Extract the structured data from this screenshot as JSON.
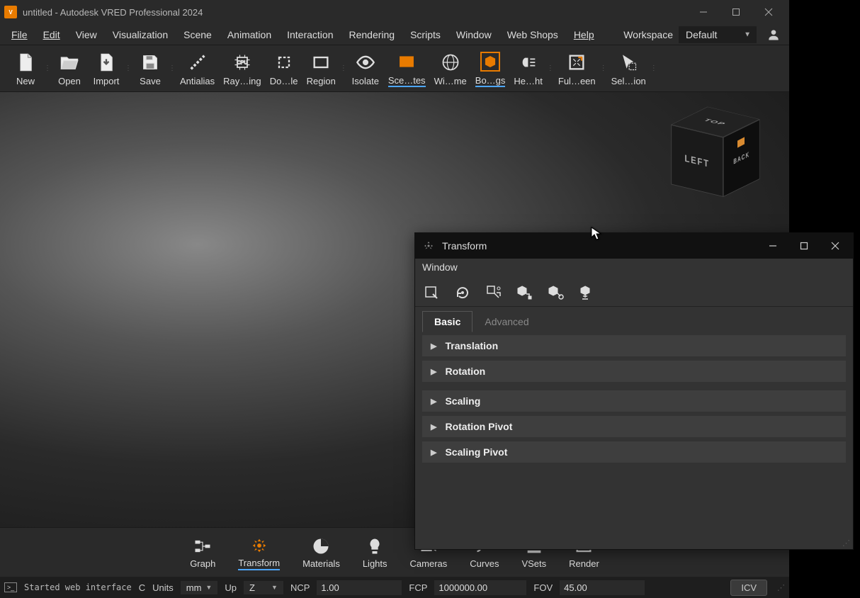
{
  "title": "untitled - Autodesk VRED Professional 2024",
  "app_icon_text": "V",
  "menu": {
    "items": [
      "File",
      "Edit",
      "View",
      "Visualization",
      "Scene",
      "Animation",
      "Interaction",
      "Rendering",
      "Scripts",
      "Window",
      "Web Shops",
      "Help"
    ]
  },
  "workspace": {
    "label": "Workspace",
    "value": "Default"
  },
  "toolbar": {
    "items": [
      {
        "id": "new",
        "label": "New"
      },
      {
        "id": "open",
        "label": "Open"
      },
      {
        "id": "import",
        "label": "Import"
      },
      {
        "id": "save",
        "label": "Save"
      },
      {
        "id": "antialias",
        "label": "Antialias"
      },
      {
        "id": "raytracing",
        "label": "Ray…ing"
      },
      {
        "id": "downscale",
        "label": "Do…le"
      },
      {
        "id": "region",
        "label": "Region"
      },
      {
        "id": "isolate",
        "label": "Isolate"
      },
      {
        "id": "sceneplates",
        "label": "Sce…tes"
      },
      {
        "id": "wireframe",
        "label": "Wi…me"
      },
      {
        "id": "boundings",
        "label": "Bo…gs"
      },
      {
        "id": "headlight",
        "label": "He…ht"
      },
      {
        "id": "fullscreen",
        "label": "Ful…een"
      },
      {
        "id": "selection",
        "label": "Sel…ion"
      }
    ]
  },
  "navcube": {
    "top": "TOP",
    "left": "LEFT",
    "back": "BACK"
  },
  "bottombar": {
    "items": [
      {
        "id": "graph",
        "label": "Graph"
      },
      {
        "id": "transform",
        "label": "Transform"
      },
      {
        "id": "materials",
        "label": "Materials"
      },
      {
        "id": "lights",
        "label": "Lights"
      },
      {
        "id": "cameras",
        "label": "Cameras"
      },
      {
        "id": "curves",
        "label": "Curves"
      },
      {
        "id": "vsets",
        "label": "VSets"
      },
      {
        "id": "render",
        "label": "Render"
      }
    ]
  },
  "statusbar": {
    "message": "Started web interface",
    "c_label": "C",
    "units_label": "Units",
    "units_value": "mm",
    "up_label": "Up",
    "up_value": "Z",
    "ncp_label": "NCP",
    "ncp_value": "1.00",
    "fcp_label": "FCP",
    "fcp_value": "1000000.00",
    "fov_label": "FOV",
    "fov_value": "45.00",
    "icv_label": "ICV"
  },
  "transform_dialog": {
    "title": "Transform",
    "menu": "Window",
    "tabs": {
      "basic": "Basic",
      "advanced": "Advanced"
    },
    "sections": [
      "Translation",
      "Rotation",
      "Scaling",
      "Rotation Pivot",
      "Scaling Pivot"
    ]
  }
}
